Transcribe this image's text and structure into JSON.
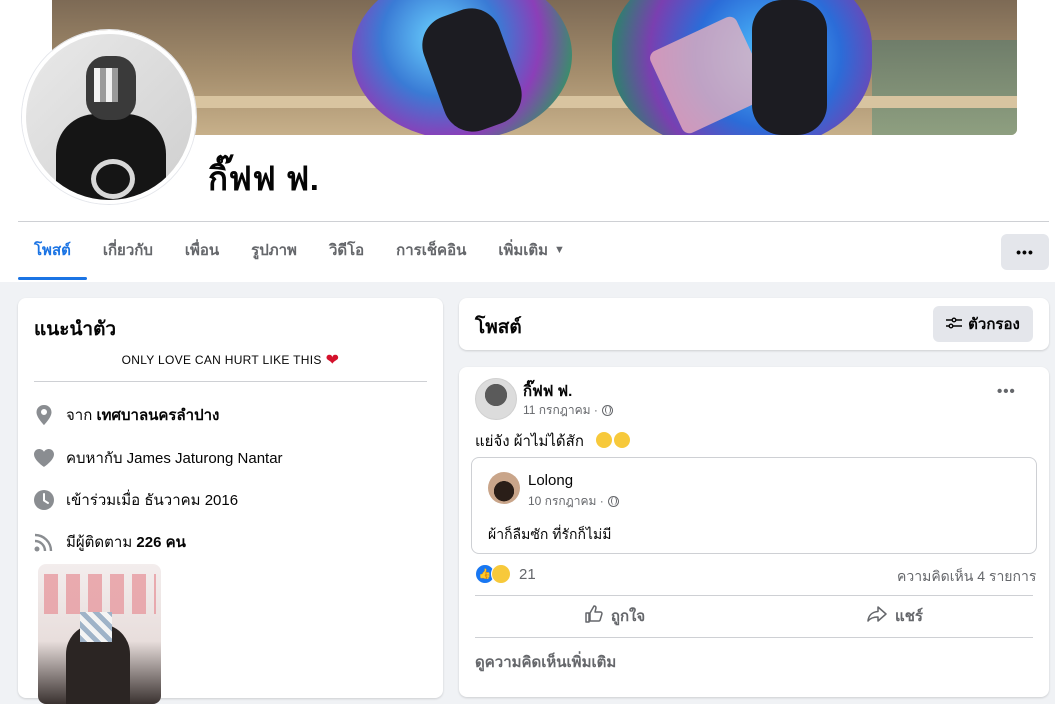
{
  "profile": {
    "name": "กิ๊ฟฟ ฟ."
  },
  "tabs": [
    {
      "label": "โพสต์",
      "active": true
    },
    {
      "label": "เกี่ยวกับ"
    },
    {
      "label": "เพื่อน"
    },
    {
      "label": "รูปภาพ"
    },
    {
      "label": "วิดีโอ"
    },
    {
      "label": "การเช็คอิน"
    },
    {
      "label": "เพิ่มเติม"
    }
  ],
  "more_button": "•••",
  "intro": {
    "title": "แนะนำตัว",
    "bio": "ONLY LOVE CAN HURT LIKE THIS",
    "bio_emoji": "❤",
    "from_prefix": "จาก",
    "from_place": "เทศบาลนครลำปาง",
    "relationship": "คบหากับ James Jaturong Nantar",
    "joined": "เข้าร่วมเมื่อ ธันวาคม 2016",
    "followers_prefix": "มีผู้ติดตาม",
    "followers_count": "226 คน"
  },
  "posts_header": {
    "title": "โพสต์",
    "filter_label": "ตัวกรอง"
  },
  "post": {
    "author": "กิ๊ฟฟ ฟ.",
    "date": "11 กรกฎาคม ·",
    "text": "แย่จัง ผ้าไม่ได้สัก",
    "shared": {
      "author": "Lolong",
      "date": "10 กรกฎาคม ·",
      "text": "ผ้าก็ลืมซัก ที่รักก็ไม่มี"
    },
    "reaction_count": "21",
    "comment_count": "ความคิดเห็น 4 รายการ",
    "like_label": "ถูกใจ",
    "share_label": "แชร์",
    "more_comments": "ดูความคิดเห็นเพิ่มเติม",
    "options": "•••"
  },
  "colors": {
    "accent": "#1b74e4",
    "background": "#f0f2f5",
    "secondary_text": "#65676b"
  }
}
